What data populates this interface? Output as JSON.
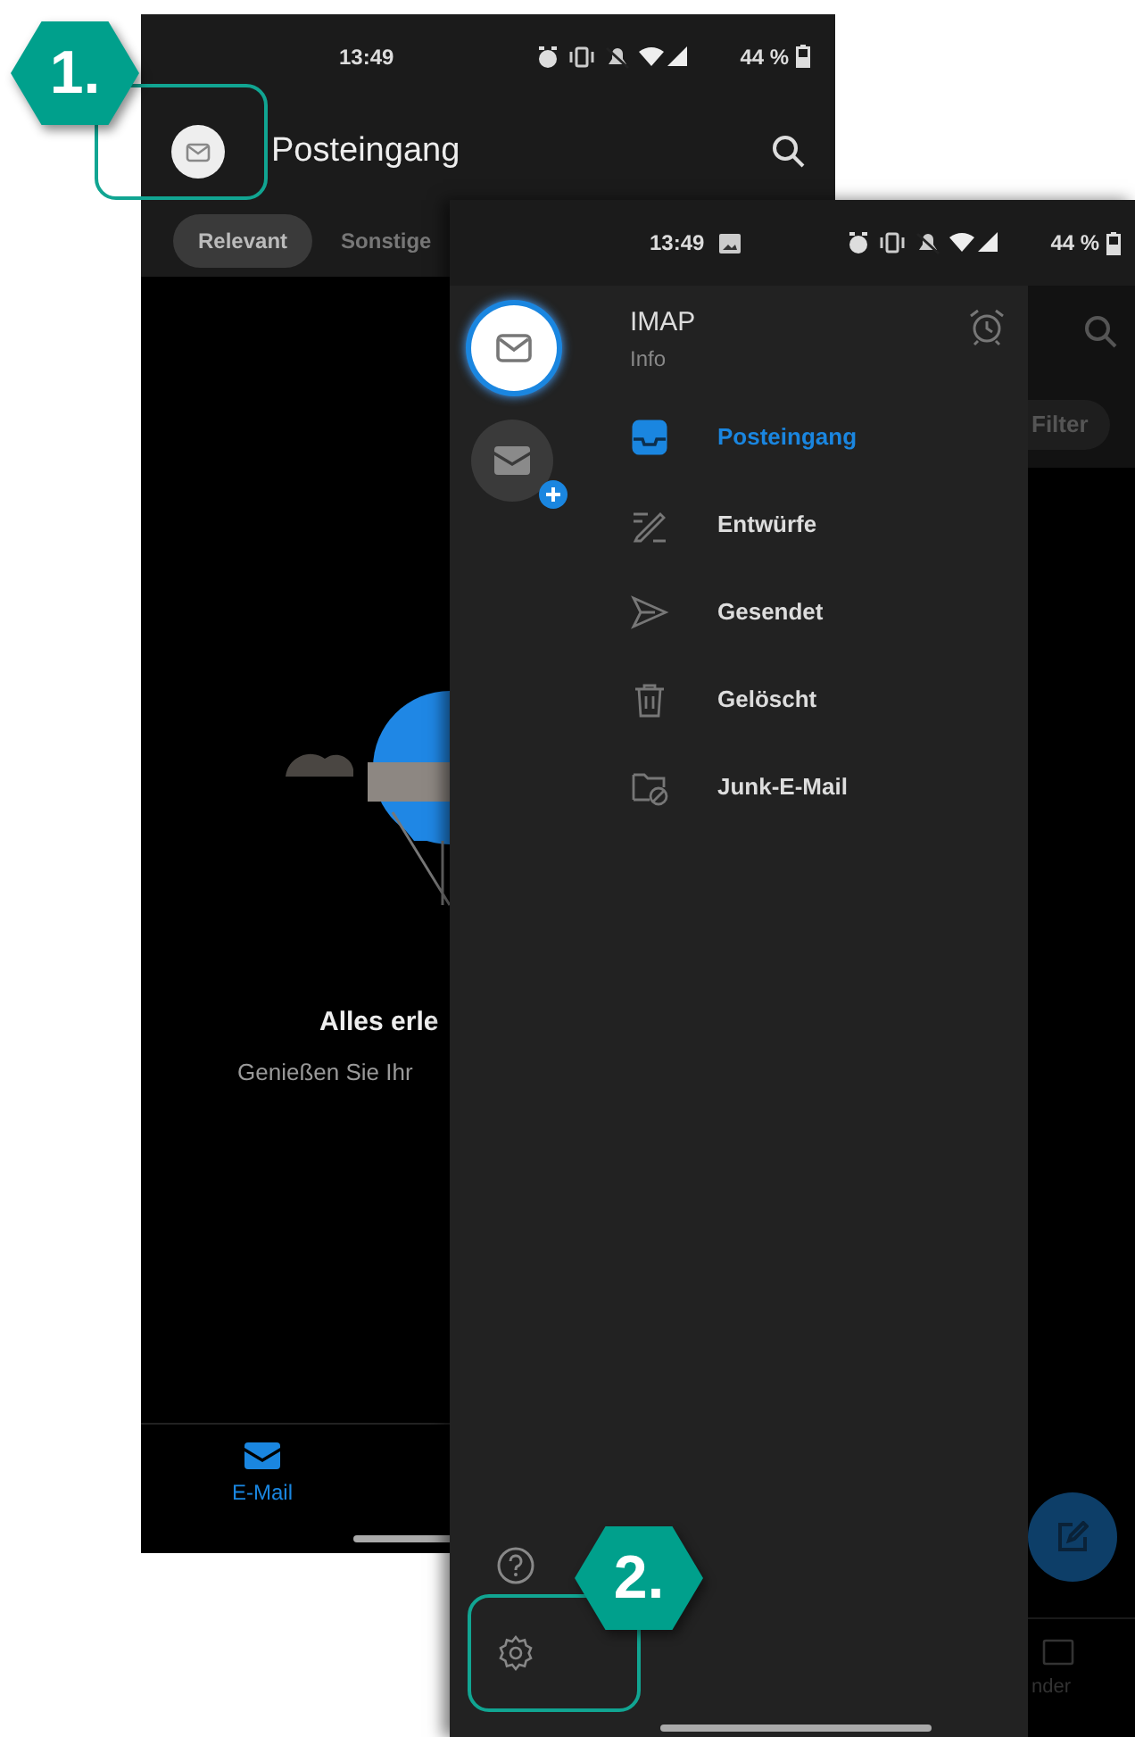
{
  "callouts": [
    {
      "label": "1."
    },
    {
      "label": "2."
    }
  ],
  "inbox_screen": {
    "status_bar": {
      "time": "13:49",
      "battery": "44 %"
    },
    "header": {
      "title": "Posteingang"
    },
    "tabs": [
      {
        "label": "Relevant",
        "selected": true
      },
      {
        "label": "Sonstige",
        "selected": false
      }
    ],
    "empty_state": {
      "title": "Alles erle",
      "message": "Genießen Sie Ihr"
    },
    "bottom_nav": [
      {
        "label": "E-Mail",
        "selected": true
      }
    ]
  },
  "drawer_screen": {
    "status_bar": {
      "time": "13:49",
      "battery": "44 %"
    },
    "accounts": [
      {
        "kind": "account",
        "selected": true
      },
      {
        "kind": "add_account",
        "selected": false
      }
    ],
    "account": {
      "name": "IMAP",
      "subtitle": "Info"
    },
    "folders": [
      {
        "label": "Posteingang",
        "selected": true
      },
      {
        "label": "Entwürfe",
        "selected": false
      },
      {
        "label": "Gesendet",
        "selected": false
      },
      {
        "label": "Gelöscht",
        "selected": false
      },
      {
        "label": "Junk-E-Mail",
        "selected": false
      }
    ],
    "backdrop": {
      "filter_chip": "Filter",
      "nav_label": "nder"
    }
  }
}
